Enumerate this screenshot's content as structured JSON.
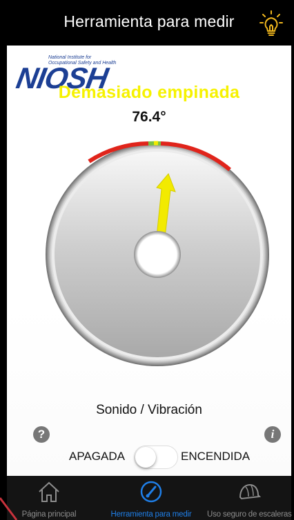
{
  "header": {
    "title": "Herramienta para medir",
    "icon": "lightbulb-icon"
  },
  "logo": {
    "small_text_line1": "National Institute for",
    "small_text_line2": "Occupational Safety and Health",
    "wordmark": "NIOSH"
  },
  "status": {
    "message": "Demasiado empinada",
    "angle": "76.4°",
    "angle_value_degrees": 76.4,
    "message_color": "#f6f200"
  },
  "gauge": {
    "arc_colors": {
      "danger": "#e0241b",
      "safe": "#7ac143",
      "needle": "#f2ea00"
    }
  },
  "controls": {
    "sound_label": "Sonido / Vibración",
    "off_label": "APAGADA",
    "on_label": "ENCENDIDA",
    "switch_on": false,
    "help_icon": "question-icon",
    "info_icon": "info-icon"
  },
  "tabbar": {
    "tabs": [
      {
        "label": "Página principal",
        "icon": "home-icon",
        "active": false
      },
      {
        "label": "Herramienta para medir",
        "icon": "gauge-icon",
        "active": true
      },
      {
        "label": "Uso seguro de escaleras",
        "icon": "hard-hat-icon",
        "active": false
      }
    ],
    "active_color": "#1f7fe8"
  }
}
